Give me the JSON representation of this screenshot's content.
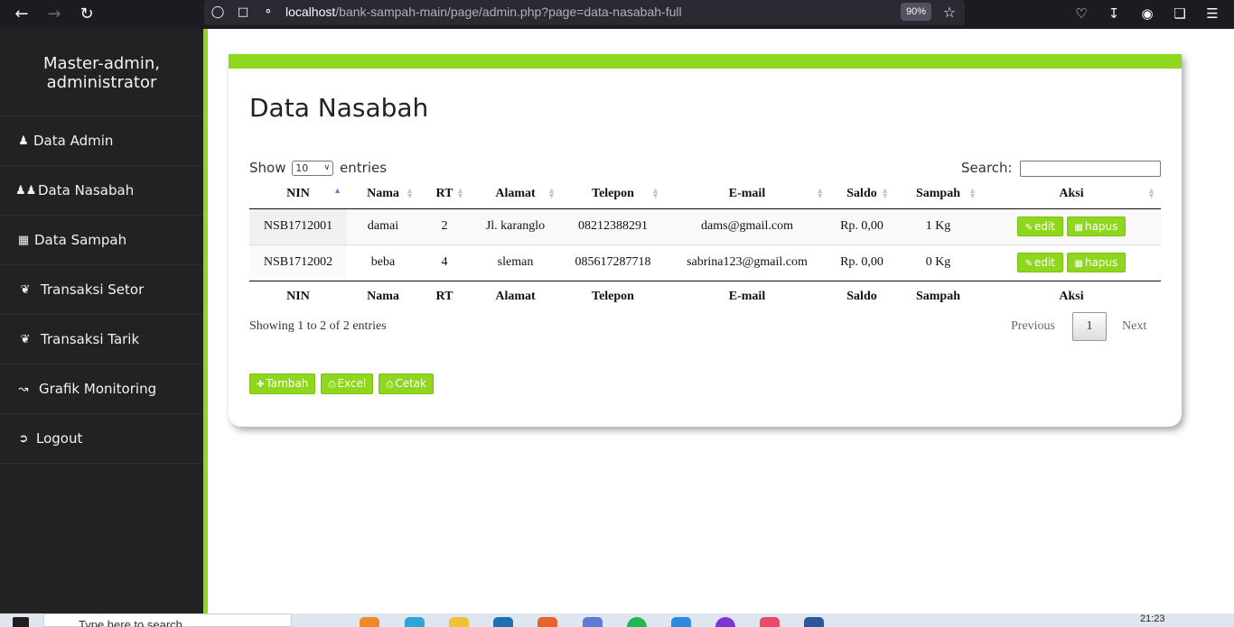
{
  "browser": {
    "url_host": "localhost",
    "url_path": "/bank-sampah-main/page/admin.php?page=data-nasabah-full",
    "zoom": "90%"
  },
  "sidebar": {
    "profile_line1": "Master-admin,",
    "profile_line2": "administrator",
    "items": [
      {
        "label": "Data Admin",
        "icon": "user-icon"
      },
      {
        "label": "Data Nasabah",
        "icon": "users-icon"
      },
      {
        "label": "Data Sampah",
        "icon": "trash-icon"
      },
      {
        "label": "Transaksi Setor",
        "icon": "handshake-icon"
      },
      {
        "label": "Transaksi Tarik",
        "icon": "handshake-icon"
      },
      {
        "label": "Grafik Monitoring",
        "icon": "line-chart-icon"
      },
      {
        "label": "Logout",
        "icon": "sign-out-icon"
      }
    ]
  },
  "page": {
    "title": "Data Nasabah",
    "show_label": "Show",
    "show_value": "10",
    "entries_label": "entries",
    "search_label": "Search:",
    "search_value": ""
  },
  "table": {
    "columns": [
      "NIN",
      "Nama",
      "RT",
      "Alamat",
      "Telepon",
      "E-mail",
      "Saldo",
      "Sampah",
      "Aksi"
    ],
    "rows": [
      {
        "nin": "NSB1712001",
        "nama": "damai",
        "rt": "2",
        "alamat": "Jl. karanglo",
        "telepon": "08212388291",
        "email": "dams@gmail.com",
        "saldo": "Rp. 0,00",
        "sampah": "1 Kg"
      },
      {
        "nin": "NSB1712002",
        "nama": "beba",
        "rt": "4",
        "alamat": "sleman",
        "telepon": "085617287718",
        "email": "sabrina123@gmail.com",
        "saldo": "Rp. 0,00",
        "sampah": "0 Kg"
      }
    ],
    "edit_label": "edit",
    "delete_label": "hapus"
  },
  "footer": {
    "info": "Showing 1 to 2 of 2 entries",
    "previous": "Previous",
    "page": "1",
    "next": "Next"
  },
  "actions": {
    "add": "Tambah",
    "excel": "Excel",
    "print": "Cetak"
  },
  "taskbar": {
    "search_placeholder": "Type here to search",
    "time": "21:23"
  },
  "colors": {
    "accent": "#8fd61f",
    "sidebar": "#222222"
  }
}
